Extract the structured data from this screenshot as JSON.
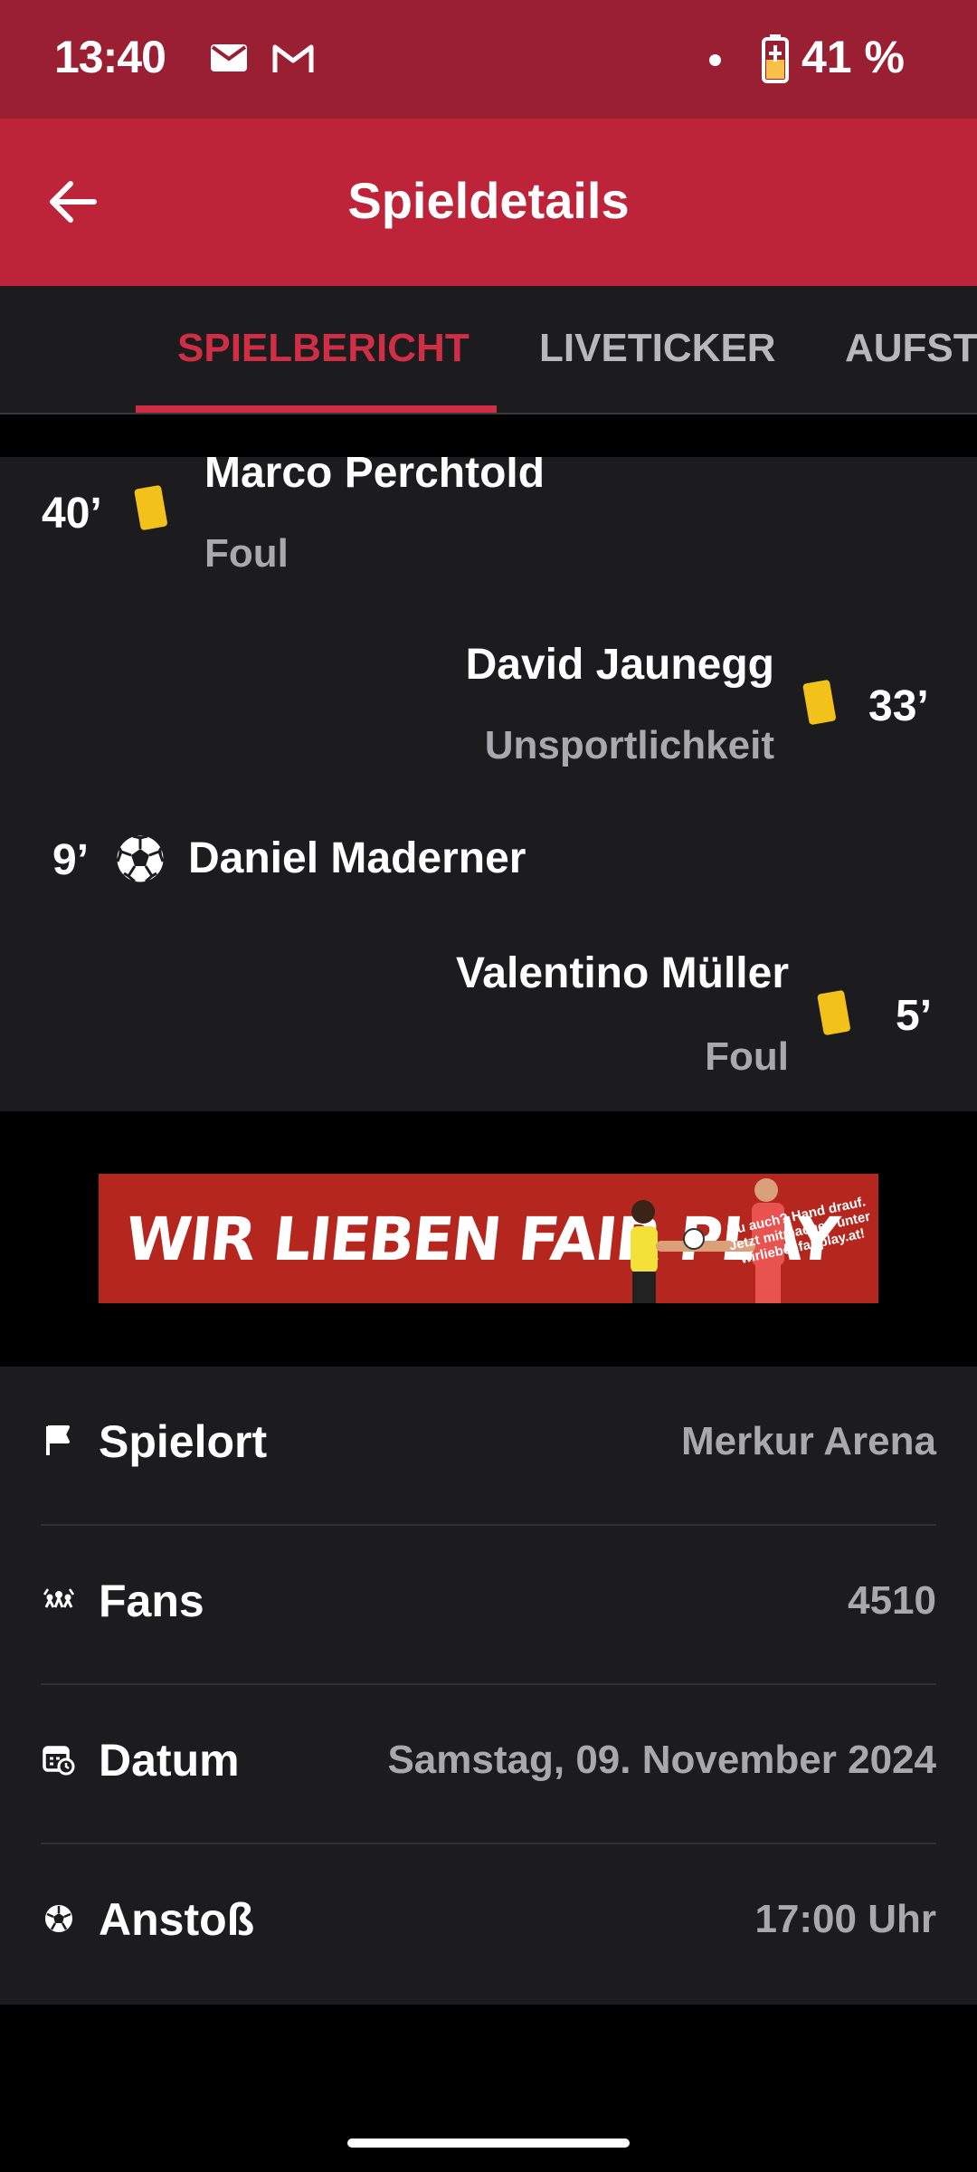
{
  "status_bar": {
    "time": "13:40",
    "battery": "41 %",
    "icons": [
      "mail-icon",
      "gmail-icon",
      "notification-dot-icon",
      "battery-charging-icon"
    ]
  },
  "app_bar": {
    "title": "Spieldetails",
    "back_icon": "arrow-left-icon"
  },
  "tabs": [
    {
      "label": "SPIELBERICHT",
      "active": true
    },
    {
      "label": "LIVETICKER",
      "active": false
    },
    {
      "label": "AUFSTELLUNG",
      "active": false
    }
  ],
  "events": [
    {
      "minute": "40’",
      "type": "yellow-card",
      "player": "Marco Perchtold",
      "reason": "Foul",
      "side": "home"
    },
    {
      "minute": "33’",
      "type": "yellow-card",
      "player": "David Jaunegg",
      "reason": "Unsportlichkeit",
      "side": "away"
    },
    {
      "minute": "9’",
      "type": "goal",
      "player": "Daniel Maderner",
      "reason": "",
      "side": "home"
    },
    {
      "minute": "5’",
      "type": "yellow-card",
      "player": "Valentino Müller",
      "reason": "Foul",
      "side": "away"
    }
  ],
  "banner": {
    "headline": "WIR LIEBEN FAIR PLAY",
    "side_text": "Du auch? Hand drauf. Jetzt mitmachen unter wirliebenfairplay.at!"
  },
  "info": [
    {
      "icon": "flag-icon",
      "label": "Spielort",
      "value": "Merkur Arena"
    },
    {
      "icon": "fans-icon",
      "label": "Fans",
      "value": "4510"
    },
    {
      "icon": "calendar-clock-icon",
      "label": "Datum",
      "value": "Samstag, 09. November 2024"
    },
    {
      "icon": "soccer-ball-icon",
      "label": "Anstoß",
      "value": "17:00 Uhr"
    }
  ],
  "colors": {
    "status_bar": "#9a1f32",
    "app_bar": "#bd243a",
    "accent": "#cf2e44",
    "panel": "#1c1c1e",
    "yellow_card": "#f2c21b"
  }
}
